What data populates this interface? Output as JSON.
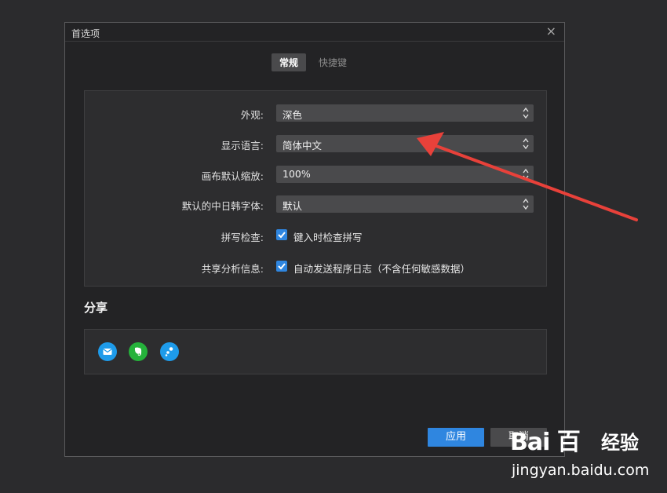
{
  "dialog": {
    "title": "首选项",
    "close_glyph": "×",
    "tabs": [
      {
        "label": "常规",
        "active": true
      },
      {
        "label": "快捷键",
        "active": false
      }
    ]
  },
  "general": {
    "appearance": {
      "label": "外观:",
      "value": "深色"
    },
    "language": {
      "label": "显示语言:",
      "value": "简体中文"
    },
    "zoom": {
      "label": "画布默认缩放:",
      "value": "100%"
    },
    "cjk_font": {
      "label": "默认的中日韩字体:",
      "value": "默认"
    },
    "spellcheck": {
      "label": "拼写检查:",
      "checkbox_text": "键入时检查拼写",
      "checked": true
    },
    "analytics": {
      "label": "共享分析信息:",
      "checkbox_text": "自动发送程序日志（不含任何敏感数据）",
      "checked": true
    }
  },
  "share": {
    "title": "分享",
    "icons": [
      {
        "name": "mail-icon",
        "color": "#1e9bea"
      },
      {
        "name": "evernote-icon",
        "color": "#25b23b"
      },
      {
        "name": "share-icon",
        "color": "#1e9bea"
      }
    ]
  },
  "buttons": {
    "ok": "应用",
    "cancel": "取消"
  },
  "watermark": {
    "logo": "Bai 百",
    "brand_cn": "经验",
    "url": "jingyan.baidu.com"
  },
  "colors": {
    "accent": "#2f86e0",
    "arrow": "#e8413a"
  }
}
